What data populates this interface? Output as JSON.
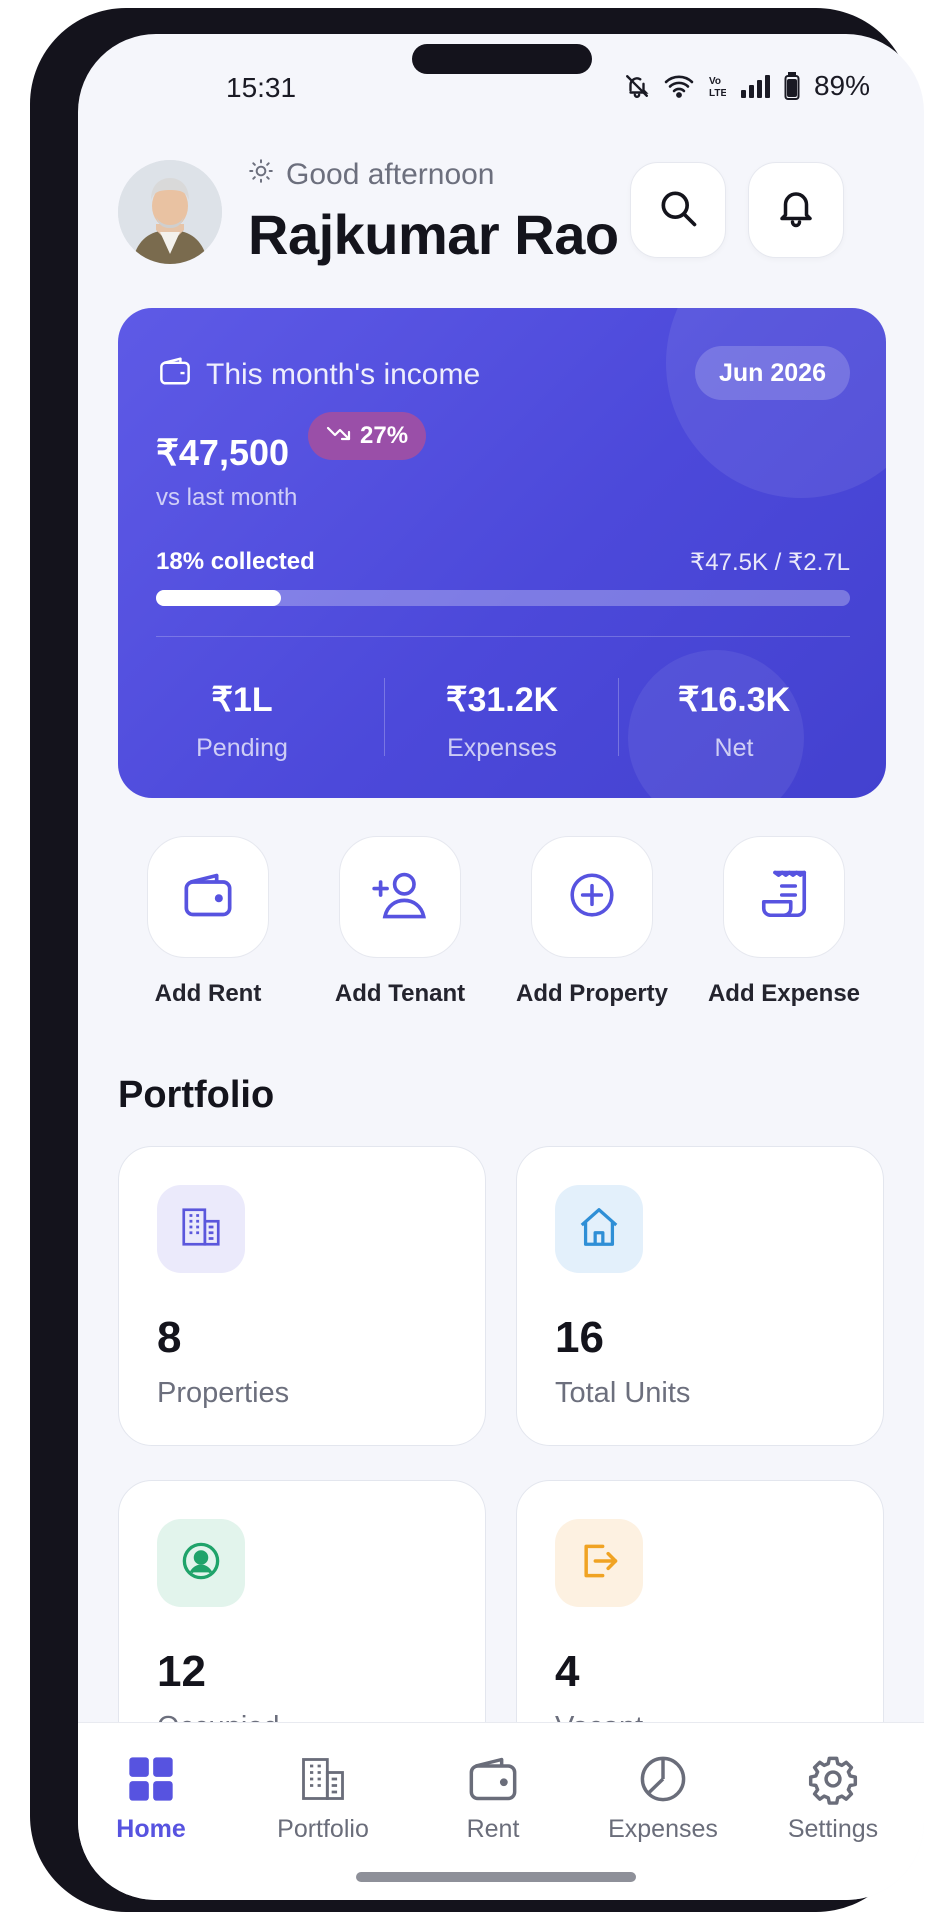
{
  "status_bar": {
    "time": "15:31",
    "battery_percent": "89%",
    "icons": [
      "bell-muted-icon",
      "wifi-icon",
      "volte-icon",
      "signal-icon",
      "battery-icon"
    ]
  },
  "header": {
    "greeting": "Good afternoon",
    "user_name": "Rajkumar Rao",
    "greeting_icon": "sun-icon",
    "search_icon": "search-icon",
    "notifications_icon": "bell-icon"
  },
  "income_card": {
    "label": "This month's income",
    "month": "Jun 2026",
    "amount": "₹47,500",
    "trend": "27%",
    "trend_direction": "down",
    "comparison_label": "vs last month",
    "collected_label": "18% collected",
    "collected_amount": "₹47.5K / ₹2.7L",
    "collected_fraction": 0.18,
    "stats": [
      {
        "value": "₹1L",
        "label": "Pending"
      },
      {
        "value": "₹31.2K",
        "label": "Expenses"
      },
      {
        "value": "₹16.3K",
        "label": "Net"
      }
    ]
  },
  "quick_actions": [
    {
      "label": "Add Rent",
      "icon": "wallet-icon"
    },
    {
      "label": "Add Tenant",
      "icon": "add-person-icon"
    },
    {
      "label": "Add Property",
      "icon": "plus-circle-icon"
    },
    {
      "label": "Add Expense",
      "icon": "receipt-icon"
    }
  ],
  "portfolio": {
    "title": "Portfolio",
    "cards": [
      {
        "value": "8",
        "label": "Properties",
        "icon": "building-icon",
        "accent": "#5b57dc",
        "tint": "#ebeafb"
      },
      {
        "value": "16",
        "label": "Total Units",
        "icon": "home-icon",
        "accent": "#2f8fd6",
        "tint": "#e3f0fb"
      },
      {
        "value": "12",
        "label": "Occupied",
        "icon": "person-circle-icon",
        "accent": "#1fa36a",
        "tint": "#e2f4ec"
      },
      {
        "value": "4",
        "label": "Vacant",
        "icon": "exit-icon",
        "accent": "#f0a323",
        "tint": "#fdf1e1"
      }
    ]
  },
  "bottom_nav": [
    {
      "label": "Home",
      "icon": "grid-icon",
      "active": true
    },
    {
      "label": "Portfolio",
      "icon": "building-icon",
      "active": false
    },
    {
      "label": "Rent",
      "icon": "wallet-icon",
      "active": false
    },
    {
      "label": "Expenses",
      "icon": "pie-chart-icon",
      "active": false
    },
    {
      "label": "Settings",
      "icon": "gear-icon",
      "active": false
    }
  ],
  "colors": {
    "primary": "#5753e0",
    "card_gradient_start": "#5e5ae6",
    "card_gradient_end": "#4341cf",
    "background": "#f5f6fb"
  }
}
